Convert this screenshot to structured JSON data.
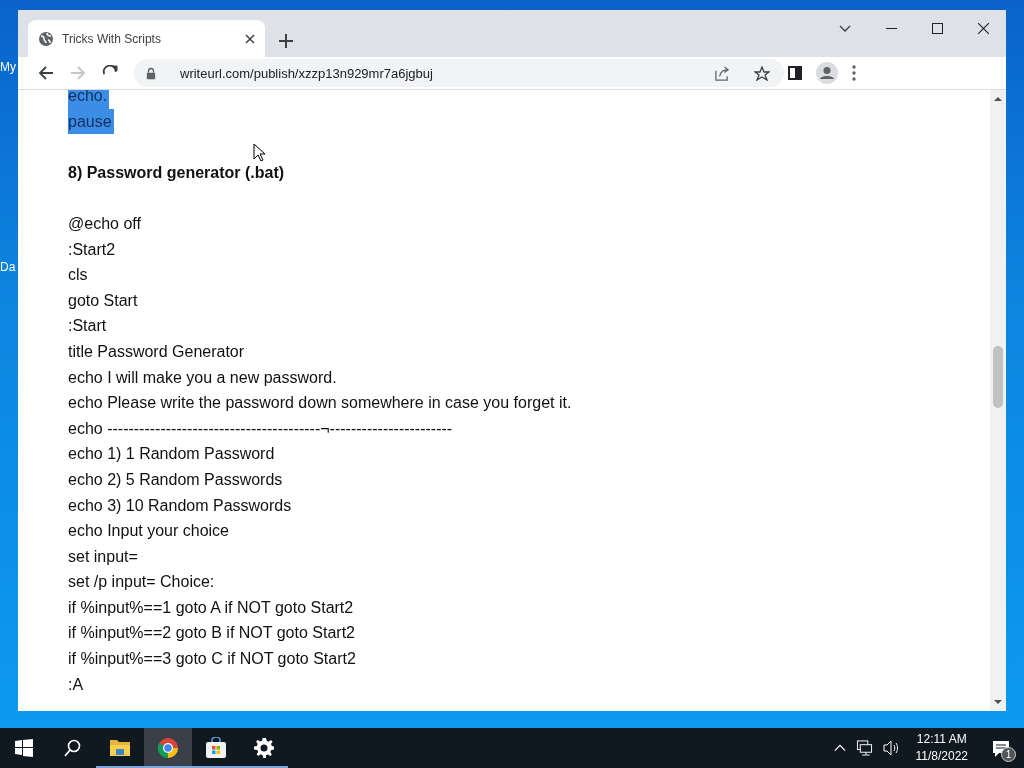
{
  "desktop_icons": [
    {
      "label": "My"
    },
    {
      "label": "Da"
    }
  ],
  "browser": {
    "tab": {
      "title": "Tricks With Scripts",
      "selected": true
    },
    "nav_buttons": [
      {
        "kind": "back",
        "disabled": false
      },
      {
        "kind": "forward",
        "disabled": true
      },
      {
        "kind": "reload",
        "disabled": false
      }
    ],
    "address": "writeurl.com/publish/xzzp13n929mr7a6jgbuj",
    "lines": [
      {
        "kind": "code",
        "text": "echo.",
        "selected": true
      },
      {
        "kind": "code",
        "text": "pause",
        "selected": true
      },
      {
        "kind": "blank"
      },
      {
        "kind": "heading",
        "text": "8) Password generator (.bat)",
        "selected": false
      },
      {
        "kind": "blank"
      },
      {
        "kind": "code",
        "text": "@echo off",
        "selected": false
      },
      {
        "kind": "code",
        "text": ":Start2",
        "selected": false
      },
      {
        "kind": "code",
        "text": "cls",
        "selected": false
      },
      {
        "kind": "code",
        "text": "goto Start",
        "selected": false
      },
      {
        "kind": "code",
        "text": ":Start",
        "selected": false
      },
      {
        "kind": "code",
        "text": "title Password Generator",
        "selected": false
      },
      {
        "kind": "code",
        "text": "echo I will make you a new password.",
        "selected": false
      },
      {
        "kind": "code",
        "text": "echo Please write the password down somewhere in case you forget it.",
        "selected": false
      },
      {
        "kind": "code",
        "text": "echo ----------------------------------------¬-----------------------",
        "selected": false
      },
      {
        "kind": "code",
        "text": "echo 1) 1 Random Password",
        "selected": false
      },
      {
        "kind": "code",
        "text": "echo 2) 5 Random Passwords",
        "selected": false
      },
      {
        "kind": "code",
        "text": "echo 3) 10 Random Passwords",
        "selected": false
      },
      {
        "kind": "code",
        "text": "echo Input your choice",
        "selected": false
      },
      {
        "kind": "code",
        "text": "set input=",
        "selected": false
      },
      {
        "kind": "code",
        "text": "set /p input= Choice:",
        "selected": false
      },
      {
        "kind": "code",
        "text": "if %input%==1 goto A if NOT goto Start2",
        "selected": false
      },
      {
        "kind": "code",
        "text": "if %input%==2 goto B if NOT goto Start2",
        "selected": false
      },
      {
        "kind": "code",
        "text": "if %input%==3 goto C if NOT goto Start2",
        "selected": false
      },
      {
        "kind": "code",
        "text": ":A",
        "selected": false
      }
    ]
  },
  "taskbar": {
    "apps": [
      {
        "kind": "files",
        "selected": false
      },
      {
        "kind": "browser",
        "selected": true
      },
      {
        "kind": "store",
        "selected": false
      },
      {
        "kind": "settings",
        "selected": false
      }
    ],
    "time": "12:11 AM",
    "date": "11/8/2022",
    "notifications": "1"
  }
}
